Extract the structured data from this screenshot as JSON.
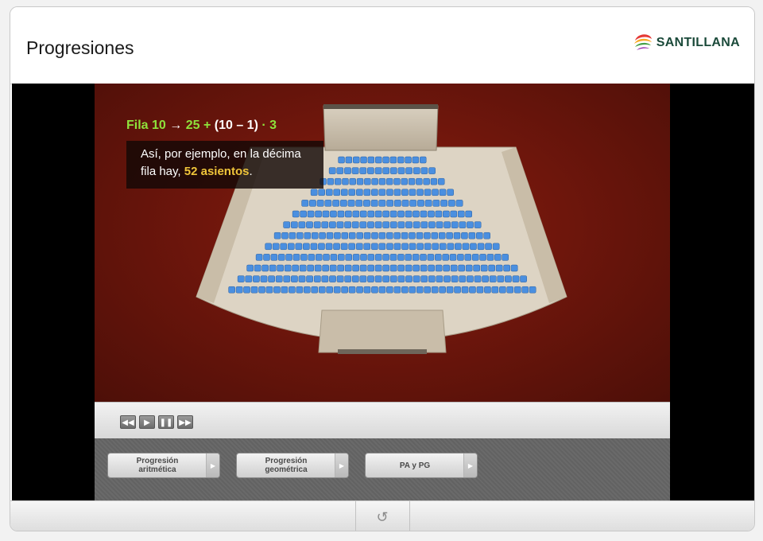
{
  "header": {
    "title": "Progresiones",
    "logo_text": "SANTILLANA"
  },
  "scene": {
    "formula": {
      "row_label": "Fila 10",
      "arrow": "→",
      "first": "25",
      "plus": "+",
      "paren": "(10 – 1)",
      "dot": "·",
      "diff": "3"
    },
    "caption": {
      "line1": "Así, por ejemplo, en la décima",
      "line2_pre": "fila hay, ",
      "highlight": "52 asientos",
      "line2_post": "."
    }
  },
  "controls": {
    "rewind": "rewind",
    "play": "play",
    "pause": "pause",
    "forward": "fast-forward"
  },
  "nav": {
    "buttons": [
      {
        "line1": "Progresión",
        "line2": "aritmética"
      },
      {
        "line1": "Progresión",
        "line2": "geométrica"
      },
      {
        "line1": "PA y PG",
        "line2": ""
      }
    ]
  },
  "footer": {
    "reload_icon": "reload-icon"
  },
  "colors": {
    "scene_bg": "#6e160c",
    "seat": "#4a8fe0",
    "formula_green": "#8ee23b",
    "highlight": "#f0c53a"
  }
}
